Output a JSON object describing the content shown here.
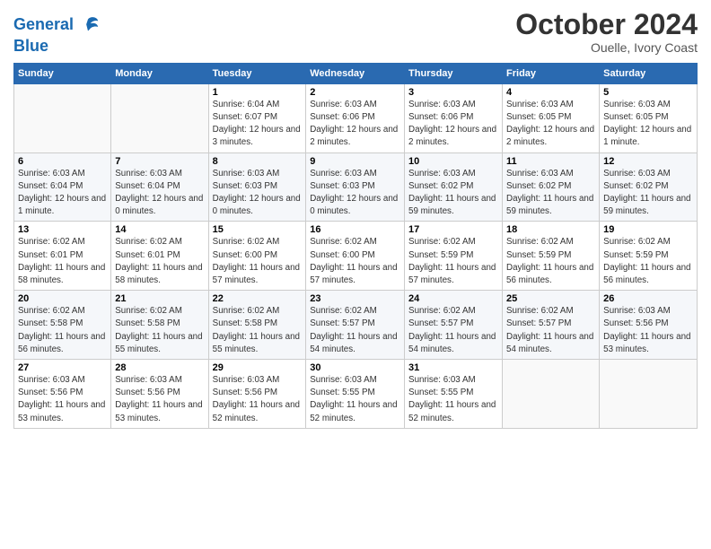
{
  "logo": {
    "line1": "General",
    "line2": "Blue"
  },
  "title": "October 2024",
  "location": "Ouelle, Ivory Coast",
  "days_of_week": [
    "Sunday",
    "Monday",
    "Tuesday",
    "Wednesday",
    "Thursday",
    "Friday",
    "Saturday"
  ],
  "weeks": [
    [
      {
        "day": "",
        "info": ""
      },
      {
        "day": "",
        "info": ""
      },
      {
        "day": "1",
        "info": "Sunrise: 6:04 AM\nSunset: 6:07 PM\nDaylight: 12 hours\nand 3 minutes."
      },
      {
        "day": "2",
        "info": "Sunrise: 6:03 AM\nSunset: 6:06 PM\nDaylight: 12 hours\nand 2 minutes."
      },
      {
        "day": "3",
        "info": "Sunrise: 6:03 AM\nSunset: 6:06 PM\nDaylight: 12 hours\nand 2 minutes."
      },
      {
        "day": "4",
        "info": "Sunrise: 6:03 AM\nSunset: 6:05 PM\nDaylight: 12 hours\nand 2 minutes."
      },
      {
        "day": "5",
        "info": "Sunrise: 6:03 AM\nSunset: 6:05 PM\nDaylight: 12 hours\nand 1 minute."
      }
    ],
    [
      {
        "day": "6",
        "info": "Sunrise: 6:03 AM\nSunset: 6:04 PM\nDaylight: 12 hours\nand 1 minute."
      },
      {
        "day": "7",
        "info": "Sunrise: 6:03 AM\nSunset: 6:04 PM\nDaylight: 12 hours\nand 0 minutes."
      },
      {
        "day": "8",
        "info": "Sunrise: 6:03 AM\nSunset: 6:03 PM\nDaylight: 12 hours\nand 0 minutes."
      },
      {
        "day": "9",
        "info": "Sunrise: 6:03 AM\nSunset: 6:03 PM\nDaylight: 12 hours\nand 0 minutes."
      },
      {
        "day": "10",
        "info": "Sunrise: 6:03 AM\nSunset: 6:02 PM\nDaylight: 11 hours\nand 59 minutes."
      },
      {
        "day": "11",
        "info": "Sunrise: 6:03 AM\nSunset: 6:02 PM\nDaylight: 11 hours\nand 59 minutes."
      },
      {
        "day": "12",
        "info": "Sunrise: 6:03 AM\nSunset: 6:02 PM\nDaylight: 11 hours\nand 59 minutes."
      }
    ],
    [
      {
        "day": "13",
        "info": "Sunrise: 6:02 AM\nSunset: 6:01 PM\nDaylight: 11 hours\nand 58 minutes."
      },
      {
        "day": "14",
        "info": "Sunrise: 6:02 AM\nSunset: 6:01 PM\nDaylight: 11 hours\nand 58 minutes."
      },
      {
        "day": "15",
        "info": "Sunrise: 6:02 AM\nSunset: 6:00 PM\nDaylight: 11 hours\nand 57 minutes."
      },
      {
        "day": "16",
        "info": "Sunrise: 6:02 AM\nSunset: 6:00 PM\nDaylight: 11 hours\nand 57 minutes."
      },
      {
        "day": "17",
        "info": "Sunrise: 6:02 AM\nSunset: 5:59 PM\nDaylight: 11 hours\nand 57 minutes."
      },
      {
        "day": "18",
        "info": "Sunrise: 6:02 AM\nSunset: 5:59 PM\nDaylight: 11 hours\nand 56 minutes."
      },
      {
        "day": "19",
        "info": "Sunrise: 6:02 AM\nSunset: 5:59 PM\nDaylight: 11 hours\nand 56 minutes."
      }
    ],
    [
      {
        "day": "20",
        "info": "Sunrise: 6:02 AM\nSunset: 5:58 PM\nDaylight: 11 hours\nand 56 minutes."
      },
      {
        "day": "21",
        "info": "Sunrise: 6:02 AM\nSunset: 5:58 PM\nDaylight: 11 hours\nand 55 minutes."
      },
      {
        "day": "22",
        "info": "Sunrise: 6:02 AM\nSunset: 5:58 PM\nDaylight: 11 hours\nand 55 minutes."
      },
      {
        "day": "23",
        "info": "Sunrise: 6:02 AM\nSunset: 5:57 PM\nDaylight: 11 hours\nand 54 minutes."
      },
      {
        "day": "24",
        "info": "Sunrise: 6:02 AM\nSunset: 5:57 PM\nDaylight: 11 hours\nand 54 minutes."
      },
      {
        "day": "25",
        "info": "Sunrise: 6:02 AM\nSunset: 5:57 PM\nDaylight: 11 hours\nand 54 minutes."
      },
      {
        "day": "26",
        "info": "Sunrise: 6:03 AM\nSunset: 5:56 PM\nDaylight: 11 hours\nand 53 minutes."
      }
    ],
    [
      {
        "day": "27",
        "info": "Sunrise: 6:03 AM\nSunset: 5:56 PM\nDaylight: 11 hours\nand 53 minutes."
      },
      {
        "day": "28",
        "info": "Sunrise: 6:03 AM\nSunset: 5:56 PM\nDaylight: 11 hours\nand 53 minutes."
      },
      {
        "day": "29",
        "info": "Sunrise: 6:03 AM\nSunset: 5:56 PM\nDaylight: 11 hours\nand 52 minutes."
      },
      {
        "day": "30",
        "info": "Sunrise: 6:03 AM\nSunset: 5:55 PM\nDaylight: 11 hours\nand 52 minutes."
      },
      {
        "day": "31",
        "info": "Sunrise: 6:03 AM\nSunset: 5:55 PM\nDaylight: 11 hours\nand 52 minutes."
      },
      {
        "day": "",
        "info": ""
      },
      {
        "day": "",
        "info": ""
      }
    ]
  ]
}
